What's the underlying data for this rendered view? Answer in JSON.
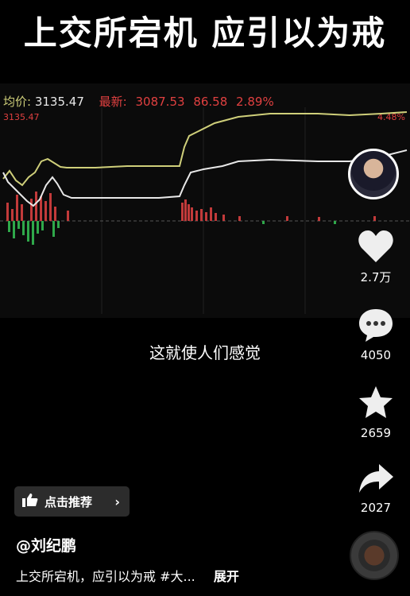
{
  "title": "上交所宕机  应引以为戒",
  "chart": {
    "avg_label": "均价:",
    "avg_value": "3135.47",
    "latest_label": "最新:",
    "latest_value": "3087.53",
    "change": "86.58",
    "change_pct": "2.89%",
    "left_price": "3135.47",
    "right_pct": "4.48%"
  },
  "subtitle": "这就使人们感觉",
  "rail": {
    "like_count": "2.7万",
    "comment_count": "4050",
    "favorite_count": "2659",
    "share_count": "2027"
  },
  "promo": {
    "label": "点击推荐"
  },
  "author": "@刘纪鹏",
  "description": "上交所宕机，应引以为戒 #大...",
  "more_label": "展开",
  "colors": {
    "accent_red": "#e04040",
    "avg_line": "#cfcf7a",
    "price_line": "#e8e8e8",
    "down_green": "#2fa84a"
  }
}
